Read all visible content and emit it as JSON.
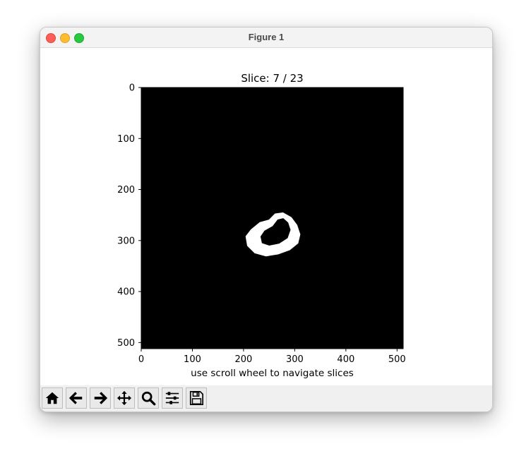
{
  "window": {
    "title": "Figure 1"
  },
  "toolbar": {
    "buttons": [
      {
        "name": "home-icon"
      },
      {
        "name": "back-arrow-icon"
      },
      {
        "name": "forward-arrow-icon"
      },
      {
        "name": "pan-icon"
      },
      {
        "name": "zoom-icon"
      },
      {
        "name": "configure-subplots-icon"
      },
      {
        "name": "save-icon"
      }
    ]
  },
  "chart_data": {
    "type": "image",
    "title": "Slice: 7 / 23",
    "xlabel": "use scroll wheel to navigate slices",
    "ylabel": "",
    "xlim": [
      0,
      512
    ],
    "ylim": [
      512,
      0
    ],
    "xticks": [
      0,
      100,
      200,
      300,
      400,
      500
    ],
    "yticks": [
      0,
      100,
      200,
      300,
      400,
      500
    ],
    "background_color": "#000000",
    "foreground_color": "#ffffff",
    "slice_current": 7,
    "slice_total": 23,
    "mask_ring": {
      "outer": [
        [
          205,
          292
        ],
        [
          215,
          279
        ],
        [
          232,
          265
        ],
        [
          250,
          260
        ],
        [
          262,
          248
        ],
        [
          277,
          246
        ],
        [
          293,
          255
        ],
        [
          304,
          270
        ],
        [
          310,
          288
        ],
        [
          306,
          305
        ],
        [
          290,
          318
        ],
        [
          268,
          326
        ],
        [
          244,
          330
        ],
        [
          222,
          324
        ],
        [
          208,
          310
        ]
      ],
      "inner": [
        [
          232,
          292
        ],
        [
          240,
          280
        ],
        [
          256,
          271
        ],
        [
          266,
          258
        ],
        [
          278,
          255
        ],
        [
          288,
          264
        ],
        [
          293,
          279
        ],
        [
          287,
          296
        ],
        [
          270,
          307
        ],
        [
          250,
          311
        ],
        [
          235,
          306
        ]
      ]
    }
  }
}
